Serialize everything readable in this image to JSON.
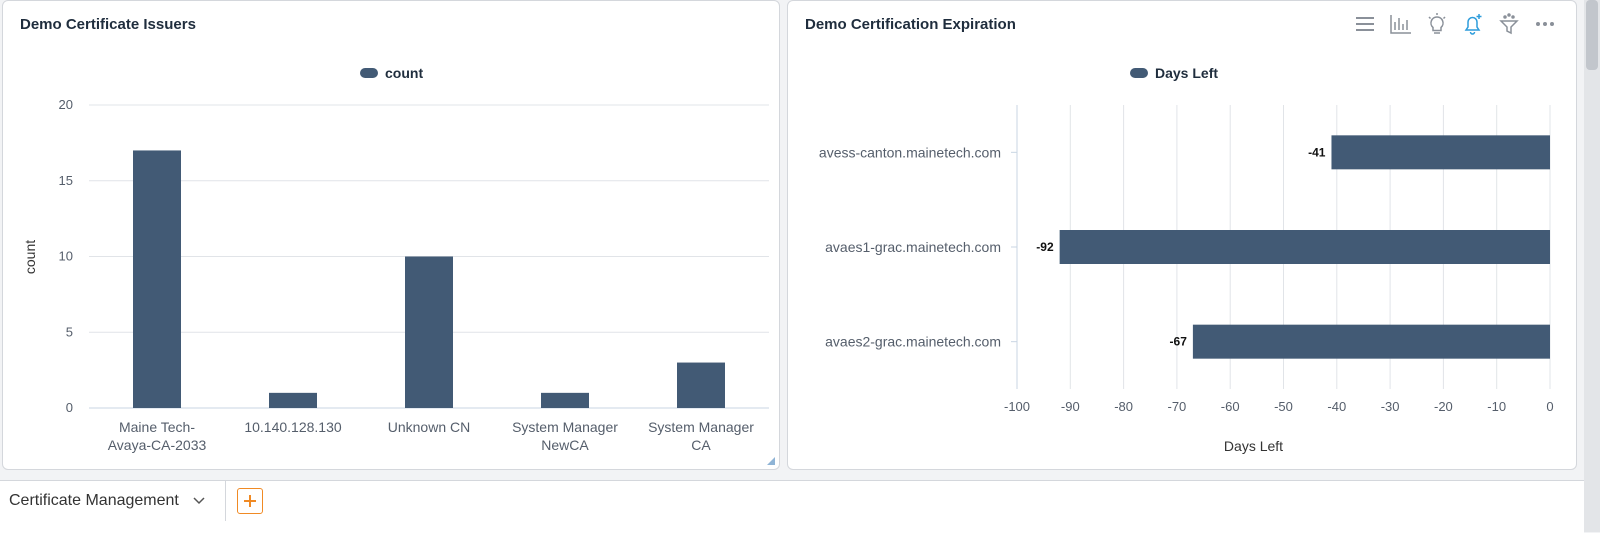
{
  "colors": {
    "bar": "#425a75",
    "grid": "#e1e4e8",
    "accent_icon": "#2d9cdb",
    "add_button": "#f08a24"
  },
  "panels": {
    "left_title": "Demo Certificate Issuers",
    "right_title": "Demo Certification Expiration"
  },
  "toolbar_icons": [
    "menu-icon",
    "bar-chart-icon",
    "lightbulb-icon",
    "bell-plus-icon",
    "filter-icon",
    "more-icon"
  ],
  "chart_data": [
    {
      "type": "bar",
      "title": "Demo Certificate Issuers",
      "legend": "count",
      "legend_position": "top-center",
      "ylabel": "count",
      "xlabel": "",
      "ylim": [
        0,
        20
      ],
      "yticks": [
        "0",
        "5",
        "10",
        "15",
        "20"
      ],
      "grid": true,
      "categories": [
        [
          "Maine Tech-",
          "Avaya-CA-2033"
        ],
        [
          "10.140.128.130"
        ],
        [
          "Unknown CN"
        ],
        [
          "System Manager",
          "NewCA"
        ],
        [
          "System Manager",
          "CA"
        ]
      ],
      "series": [
        {
          "name": "count",
          "values": [
            17,
            1,
            10,
            1,
            3
          ]
        }
      ]
    },
    {
      "type": "bar",
      "orientation": "horizontal",
      "title": "Demo Certification Expiration",
      "legend": "Days Left",
      "legend_position": "top-center",
      "xlabel": "Days Left",
      "xlim": [
        -100,
        0
      ],
      "xticks": [
        "-100",
        "-90",
        "-80",
        "-70",
        "-60",
        "-50",
        "-40",
        "-30",
        "-20",
        "-10",
        "0"
      ],
      "grid": true,
      "categories": [
        "avess-canton.mainetech.com",
        "avaes1-grac.mainetech.com",
        "avaes2-grac.mainetech.com"
      ],
      "series": [
        {
          "name": "Days Left",
          "values": [
            -41,
            -92,
            -67
          ]
        }
      ],
      "data_labels": [
        "-41",
        "-92",
        "-67"
      ]
    }
  ],
  "bottom_bar": {
    "tab_label": "Certificate Management"
  }
}
